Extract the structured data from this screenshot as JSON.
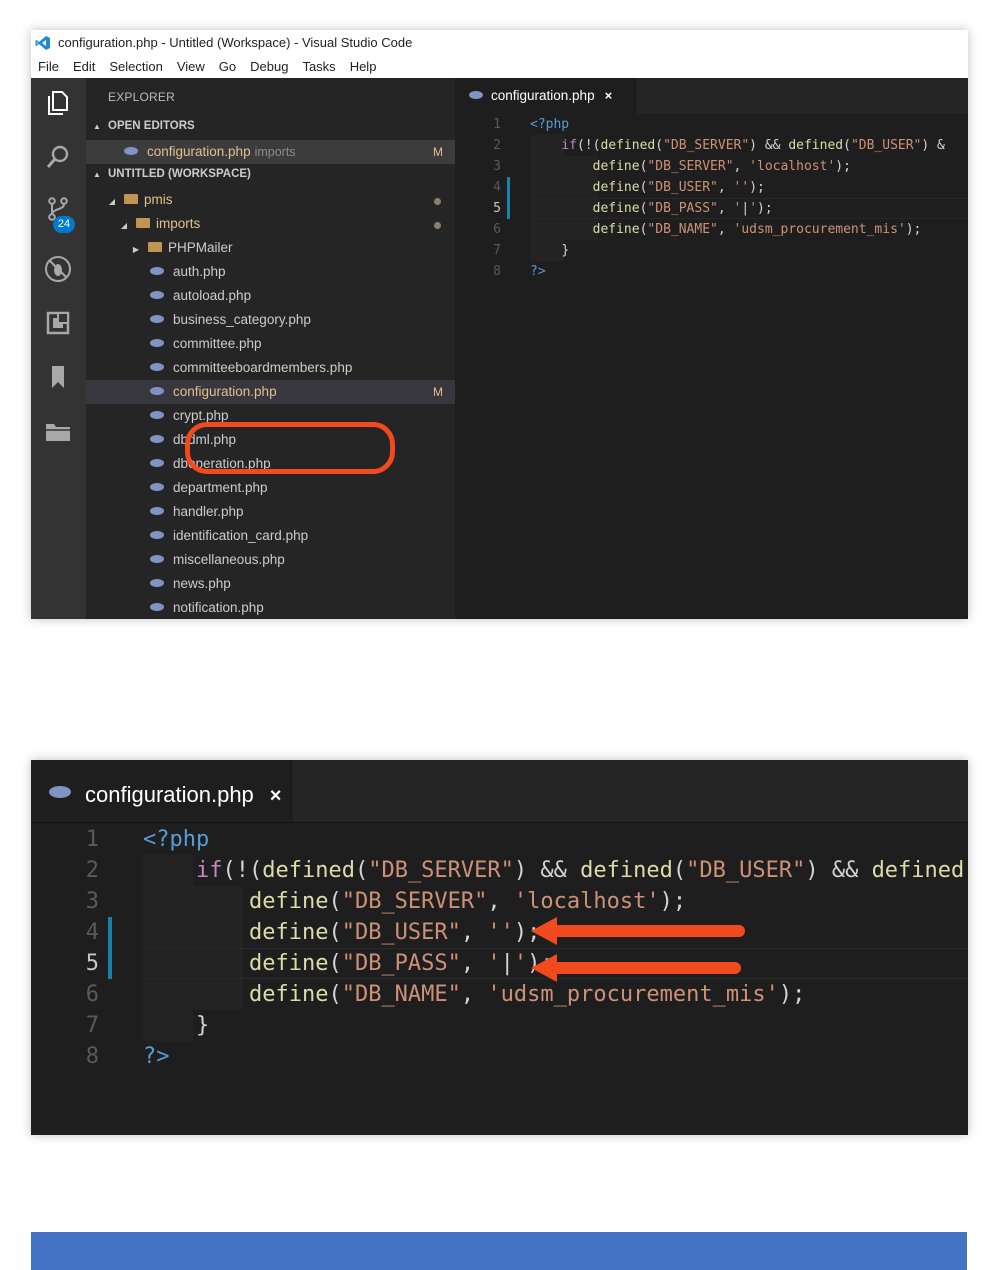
{
  "screenshot1": {
    "window_title": "configuration.php - Untitled (Workspace) - Visual Studio Code",
    "menu": [
      "File",
      "Edit",
      "Selection",
      "View",
      "Go",
      "Debug",
      "Tasks",
      "Help"
    ],
    "activity_badge": "24",
    "sidebar": {
      "explorer_title": "EXPLORER",
      "open_editors_label": "OPEN EDITORS",
      "open_editor_file": "configuration.php",
      "open_editor_folder": "imports",
      "open_editor_status": "M",
      "workspace_label": "UNTITLED (WORKSPACE)",
      "root_folder": "pmis",
      "sub_folder": "imports",
      "phpmailer_folder": "PHPMailer",
      "files": [
        "auth.php",
        "autoload.php",
        "business_category.php",
        "committee.php",
        "committeeboardmembers.php",
        "configuration.php",
        "crypt.php",
        "dbdml.php",
        "dboperation.php",
        "department.php",
        "handler.php",
        "identification_card.php",
        "miscellaneous.php",
        "news.php",
        "notification.php"
      ],
      "selected_status": "M"
    },
    "tab_label": "configuration.php",
    "tab_close": "×",
    "line_numbers": [
      "1",
      "2",
      "3",
      "4",
      "5",
      "6",
      "7",
      "8"
    ]
  },
  "screenshot2": {
    "tab_label": "configuration.php",
    "tab_close": "×",
    "line_numbers": [
      "1",
      "2",
      "3",
      "4",
      "5",
      "6",
      "7",
      "8"
    ]
  },
  "code": {
    "open_tag": "<?php",
    "if_kw": "if",
    "defined_fn": "defined",
    "define_fn": "define",
    "s_db_server": "\"DB_SERVER\"",
    "s_db_user": "\"DB_USER\"",
    "s_db_pass": "\"DB_PASS\"",
    "s_db_name": "\"DB_NAME\"",
    "s_localhost": "'localhost'",
    "s_empty": "''",
    "s_quote": "'",
    "s_mis": "'udsm_procurement_mis'",
    "close_brace": "}",
    "close_tag": "?>"
  },
  "colors": {
    "annotation": "#f04a1e",
    "bottom_bar": "#4472c4",
    "vscode_blue": "#007acc"
  }
}
